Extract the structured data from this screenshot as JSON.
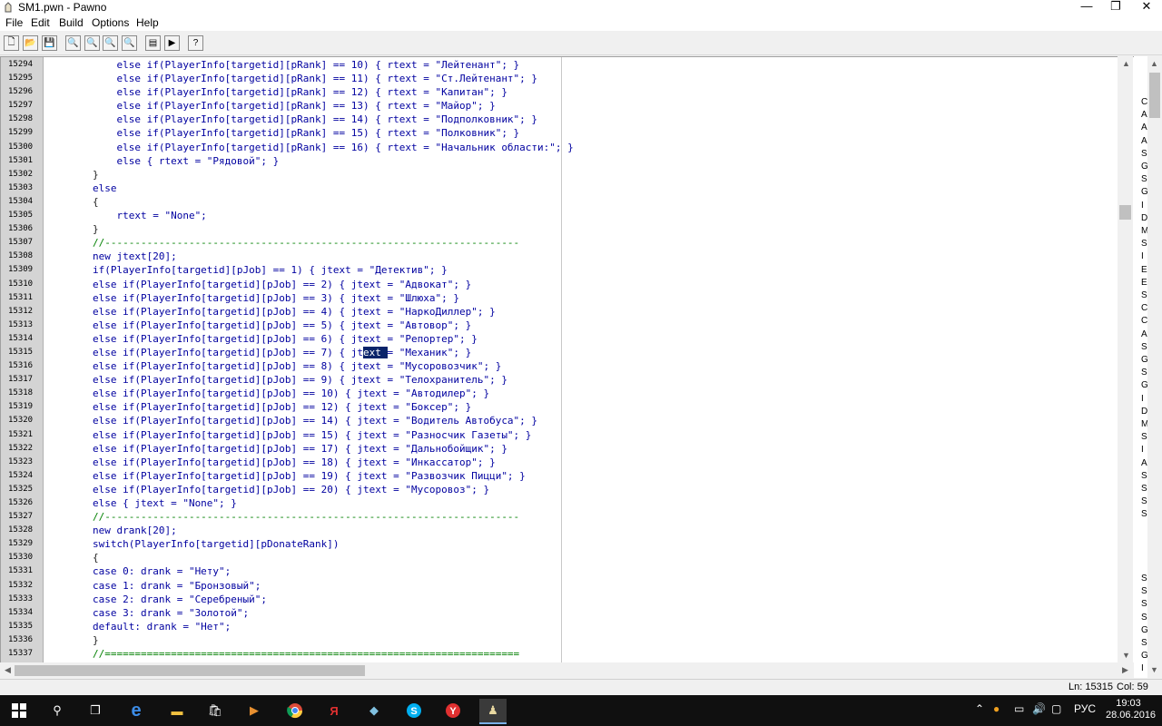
{
  "window": {
    "title": "SM1.pwn - Pawno"
  },
  "menu": [
    "File",
    "Edit",
    "Build",
    "Options",
    "Help"
  ],
  "toolbar": {
    "buttons": [
      {
        "name": "new-file-button",
        "glyph": "🗋"
      },
      {
        "name": "open-file-button",
        "glyph": "📂"
      },
      {
        "name": "save-file-button",
        "glyph": "💾"
      },
      {
        "name": "find-button",
        "glyph": "🔍"
      },
      {
        "name": "find-next-button",
        "glyph": "🔍"
      },
      {
        "name": "replace-button",
        "glyph": "🔍"
      },
      {
        "name": "replace-all-button",
        "glyph": "🔍"
      },
      {
        "name": "function-list-button",
        "glyph": "▤"
      },
      {
        "name": "compile-button",
        "glyph": "▶"
      },
      {
        "name": "help-button",
        "glyph": "?"
      }
    ]
  },
  "editor": {
    "lines": [
      {
        "n": "15294",
        "t": "            else if(PlayerInfo[targetid][pRank] == 10) { rtext = \"Лейтенант\"; }",
        "c": "code"
      },
      {
        "n": "15295",
        "t": "            else if(PlayerInfo[targetid][pRank] == 11) { rtext = \"Ст.Лейтенант\"; }",
        "c": "code"
      },
      {
        "n": "15296",
        "t": "            else if(PlayerInfo[targetid][pRank] == 12) { rtext = \"Капитан\"; }",
        "c": "code"
      },
      {
        "n": "15297",
        "t": "            else if(PlayerInfo[targetid][pRank] == 13) { rtext = \"Майор\"; }",
        "c": "code"
      },
      {
        "n": "15298",
        "t": "            else if(PlayerInfo[targetid][pRank] == 14) { rtext = \"Подполковник\"; }",
        "c": "code"
      },
      {
        "n": "15299",
        "t": "            else if(PlayerInfo[targetid][pRank] == 15) { rtext = \"Полковник\"; }",
        "c": "code"
      },
      {
        "n": "15300",
        "t": "            else if(PlayerInfo[targetid][pRank] == 16) { rtext = \"Начальник области:\"; }",
        "c": "code"
      },
      {
        "n": "15301",
        "t": "            else { rtext = \"Рядовой\"; }",
        "c": "code"
      },
      {
        "n": "15302",
        "t": "        }",
        "c": "code dark"
      },
      {
        "n": "15303",
        "t": "        else",
        "c": "code"
      },
      {
        "n": "15304",
        "t": "        {",
        "c": "code dark"
      },
      {
        "n": "15305",
        "t": "            rtext = \"None\";",
        "c": "code"
      },
      {
        "n": "15306",
        "t": "        }",
        "c": "code dark"
      },
      {
        "n": "15307",
        "t": "        //---------------------------------------------------------------------",
        "c": "code comment"
      },
      {
        "n": "15308",
        "t": "        new jtext[20];",
        "c": "code"
      },
      {
        "n": "15309",
        "t": "        if(PlayerInfo[targetid][pJob] == 1) { jtext = \"Детектив\"; }",
        "c": "code"
      },
      {
        "n": "15310",
        "t": "        else if(PlayerInfo[targetid][pJob] == 2) { jtext = \"Адвокат\"; }",
        "c": "code"
      },
      {
        "n": "15311",
        "t": "        else if(PlayerInfo[targetid][pJob] == 3) { jtext = \"Шлюха\"; }",
        "c": "code"
      },
      {
        "n": "15312",
        "t": "        else if(PlayerInfo[targetid][pJob] == 4) { jtext = \"НаркоДиллер\"; }",
        "c": "code"
      },
      {
        "n": "15313",
        "t": "        else if(PlayerInfo[targetid][pJob] == 5) { jtext = \"Автовор\"; }",
        "c": "code"
      },
      {
        "n": "15314",
        "t": "        else if(PlayerInfo[targetid][pJob] == 6) { jtext = \"Репортер\"; }",
        "c": "code"
      },
      {
        "n": "15315",
        "t": "        else if(PlayerInfo[targetid][pJob] == 7) { jtext = \"Механик\"; }",
        "c": "code",
        "sel": [
          53,
          57
        ]
      },
      {
        "n": "15316",
        "t": "        else if(PlayerInfo[targetid][pJob] == 8) { jtext = \"Мусоровозчик\"; }",
        "c": "code"
      },
      {
        "n": "15317",
        "t": "        else if(PlayerInfo[targetid][pJob] == 9) { jtext = \"Телохранитель\"; }",
        "c": "code"
      },
      {
        "n": "15318",
        "t": "        else if(PlayerInfo[targetid][pJob] == 10) { jtext = \"Автодилер\"; }",
        "c": "code"
      },
      {
        "n": "15319",
        "t": "        else if(PlayerInfo[targetid][pJob] == 12) { jtext = \"Боксер\"; }",
        "c": "code"
      },
      {
        "n": "15320",
        "t": "        else if(PlayerInfo[targetid][pJob] == 14) { jtext = \"Водитель Автобуса\"; }",
        "c": "code"
      },
      {
        "n": "15321",
        "t": "        else if(PlayerInfo[targetid][pJob] == 15) { jtext = \"Разносчик Газеты\"; }",
        "c": "code"
      },
      {
        "n": "15322",
        "t": "        else if(PlayerInfo[targetid][pJob] == 17) { jtext = \"Дальнобойщик\"; }",
        "c": "code"
      },
      {
        "n": "15323",
        "t": "        else if(PlayerInfo[targetid][pJob] == 18) { jtext = \"Инкассатор\"; }",
        "c": "code"
      },
      {
        "n": "15324",
        "t": "        else if(PlayerInfo[targetid][pJob] == 19) { jtext = \"Развозчик Пицци\"; }",
        "c": "code"
      },
      {
        "n": "15325",
        "t": "        else if(PlayerInfo[targetid][pJob] == 20) { jtext = \"Мусоровоз\"; }",
        "c": "code"
      },
      {
        "n": "15326",
        "t": "        else { jtext = \"None\"; }",
        "c": "code"
      },
      {
        "n": "15327",
        "t": "        //---------------------------------------------------------------------",
        "c": "code comment"
      },
      {
        "n": "15328",
        "t": "        new drank[20];",
        "c": "code"
      },
      {
        "n": "15329",
        "t": "        switch(PlayerInfo[targetid][pDonateRank])",
        "c": "code"
      },
      {
        "n": "15330",
        "t": "        {",
        "c": "code dark"
      },
      {
        "n": "15331",
        "t": "        case 0: drank = \"Нету\";",
        "c": "code"
      },
      {
        "n": "15332",
        "t": "        case 1: drank = \"Бронзовый\";",
        "c": "code"
      },
      {
        "n": "15333",
        "t": "        case 2: drank = \"Серебреный\";",
        "c": "code"
      },
      {
        "n": "15334",
        "t": "        case 3: drank = \"Золотой\";",
        "c": "code"
      },
      {
        "n": "15335",
        "t": "        default: drank = \"Нет\";",
        "c": "code"
      },
      {
        "n": "15336",
        "t": "        }",
        "c": "code dark"
      },
      {
        "n": "15337",
        "t": "        //=====================================================================",
        "c": "code comment"
      }
    ]
  },
  "side_panel": {
    "group1": [
      "C",
      "A",
      "A",
      "A",
      "S",
      "G",
      "S",
      "G",
      "I",
      "D",
      "M",
      "S",
      "I",
      "E",
      "E",
      "S",
      "C",
      "C",
      "A",
      "S",
      "G",
      "S",
      "G",
      "I",
      "D",
      "M",
      "S",
      "I",
      "A",
      "S",
      "S",
      "S",
      "S"
    ],
    "group2": [
      "S",
      "S",
      "S",
      "S",
      "G",
      "S",
      "G",
      "I"
    ]
  },
  "status": {
    "position": "Ln: 15315",
    "column": "Col: 59"
  },
  "taskbar": {
    "language": "РУС",
    "time": "19:03",
    "date": "28.06.2016"
  }
}
